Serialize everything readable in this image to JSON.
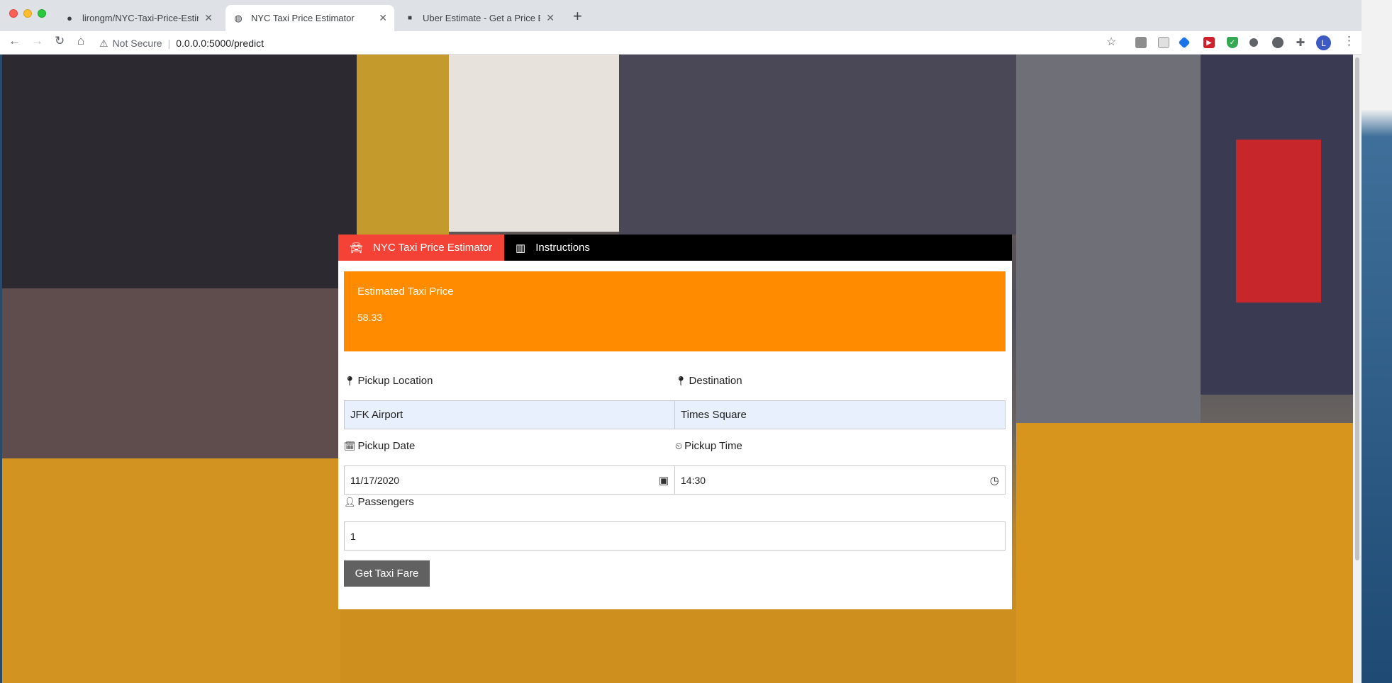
{
  "browser": {
    "tabs": [
      {
        "title": "lirongm/NYC-Taxi-Price-Estima",
        "icon": "github-icon"
      },
      {
        "title": "NYC Taxi Price Estimator",
        "icon": "globe-icon"
      },
      {
        "title": "Uber Estimate - Get a Price Est",
        "icon": "uber-icon"
      }
    ],
    "security_label": "Not Secure",
    "url": "0.0.0.0:5000/predict",
    "profile_initial": "L"
  },
  "app": {
    "nav": {
      "estimator_label": "NYC Taxi Price Estimator",
      "instructions_label": "Instructions"
    },
    "result": {
      "label": "Estimated Taxi Price",
      "value": "58.33"
    },
    "form": {
      "pickup_label": "Pickup Location",
      "pickup_value": "JFK Airport",
      "destination_label": "Destination",
      "destination_value": "Times Square",
      "date_label": "Pickup Date",
      "date_value": "11/17/2020",
      "time_label": "Pickup Time",
      "time_value": "14:30",
      "passengers_label": "Passengers",
      "passengers_value": "1",
      "submit_label": "Get Taxi Fare"
    }
  },
  "colors": {
    "accent_red": "#f44336",
    "result_orange": "#ff8c00",
    "button_gray": "#616161"
  }
}
